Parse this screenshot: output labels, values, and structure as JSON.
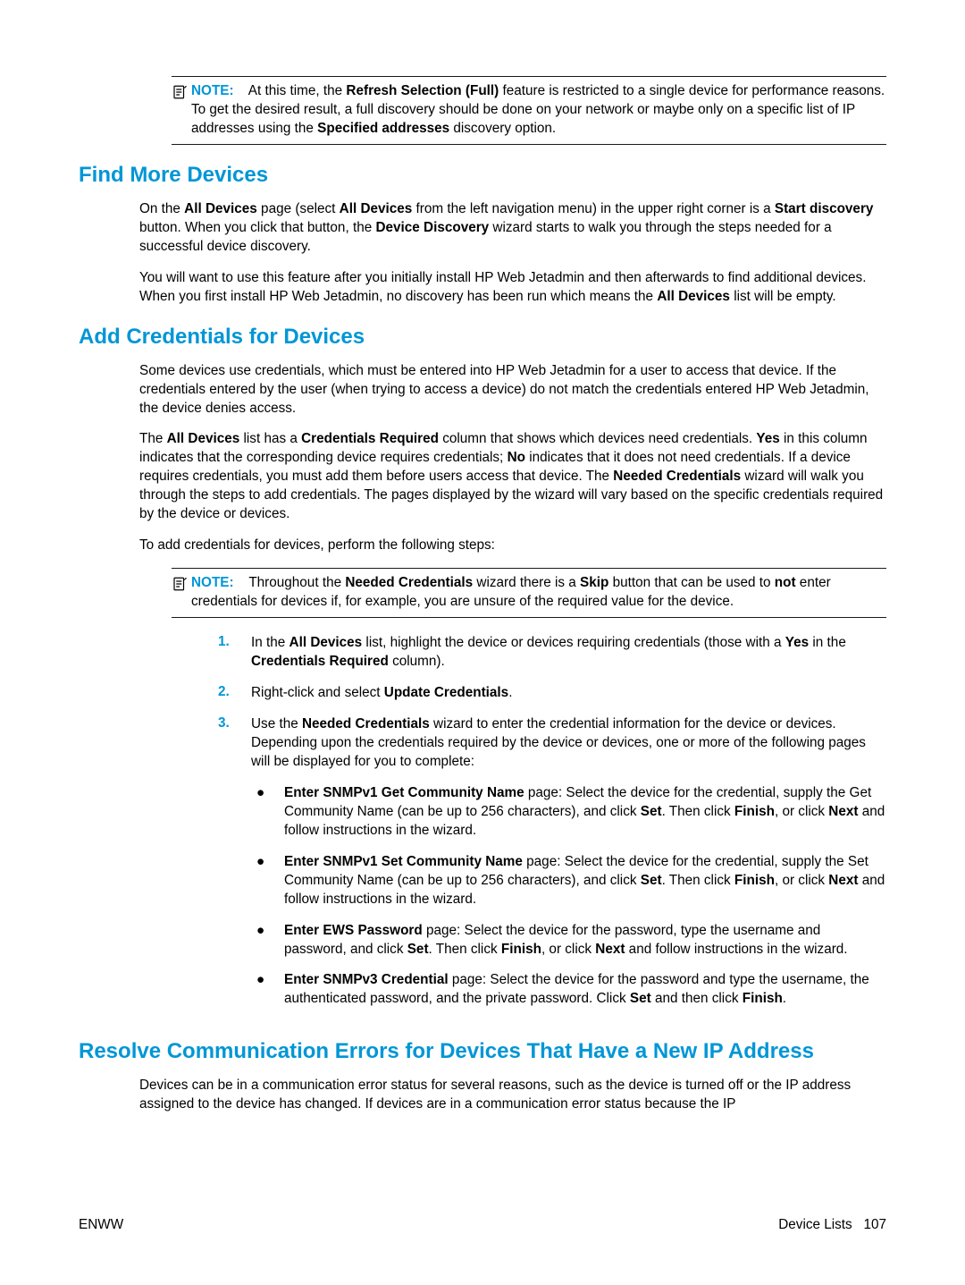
{
  "note_top": {
    "label": "NOTE:",
    "text_before": "At this time, the ",
    "bold1": "Refresh Selection (Full)",
    "text_mid": " feature is restricted to a single device for performance reasons. To get the desired result, a full discovery should be done on your network or maybe only on a specific list of IP addresses using the ",
    "bold2": "Specified addresses",
    "text_after": " discovery option."
  },
  "section1": {
    "title": "Find More Devices",
    "p1_a": "On the ",
    "p1_b": "All Devices",
    "p1_c": " page (select ",
    "p1_d": "All Devices",
    "p1_e": " from the left navigation menu) in the upper right corner is a ",
    "p1_f": "Start discovery",
    "p1_g": " button. When you click that button, the ",
    "p1_h": "Device Discovery",
    "p1_i": " wizard starts to walk you through the steps needed for a successful device discovery.",
    "p2_a": "You will want to use this feature after you initially install HP Web Jetadmin and then afterwards to find additional devices. When you first install HP Web Jetadmin, no discovery has been run which means the ",
    "p2_b": "All Devices",
    "p2_c": " list will be empty."
  },
  "section2": {
    "title": "Add Credentials for Devices",
    "p1": "Some devices use credentials, which must be entered into HP Web Jetadmin for a user to access that device. If the credentials entered by the user (when trying to access a device) do not match the credentials entered HP Web Jetadmin, the device denies access.",
    "p2_a": "The ",
    "p2_b": "All Devices",
    "p2_c": " list has a ",
    "p2_d": "Credentials Required",
    "p2_e": " column that shows which devices need credentials. ",
    "p2_f": "Yes",
    "p2_g": " in this column indicates that the corresponding device requires credentials; ",
    "p2_h": "No",
    "p2_i": " indicates that it does not need credentials. If a device requires credentials, you must add them before users access that device. The ",
    "p2_j": "Needed Credentials",
    "p2_k": " wizard will walk you through the steps to add credentials. The pages displayed by the wizard will vary based on the specific credentials required by the device or devices.",
    "p3": "To add credentials for devices, perform the following steps:",
    "note": {
      "label": "NOTE:",
      "a": "Throughout the ",
      "b": "Needed Credentials",
      "c": " wizard there is a ",
      "d": "Skip",
      "e": " button that can be used to ",
      "f": "not",
      "g": " enter credentials for devices if, for example, you are unsure of the required value for the device."
    },
    "step1": {
      "num": "1.",
      "a": "In the ",
      "b": "All Devices",
      "c": " list, highlight the device or devices requiring credentials (those with a ",
      "d": "Yes",
      "e": " in the ",
      "f": "Credentials Required",
      "g": " column)."
    },
    "step2": {
      "num": "2.",
      "a": "Right-click and select ",
      "b": "Update Credentials",
      "c": "."
    },
    "step3": {
      "num": "3.",
      "a": "Use the ",
      "b": "Needed Credentials",
      "c": " wizard to enter the credential information for the device or devices. Depending upon the credentials required by the device or devices, one or more of the following pages will be displayed for you to complete:"
    },
    "bullet1": {
      "b1": "Enter SNMPv1 Get Community Name",
      "t1": " page: Select the device for the credential, supply the Get Community Name (can be up to 256 characters), and click ",
      "b2": "Set",
      "t2": ". Then click ",
      "b3": "Finish",
      "t3": ", or click ",
      "b4": "Next",
      "t4": " and follow instructions in the wizard."
    },
    "bullet2": {
      "b1": "Enter SNMPv1 Set Community Name",
      "t1": " page: Select the device for the credential, supply the Set Community Name (can be up to 256 characters), and click ",
      "b2": "Set",
      "t2": ". Then click ",
      "b3": "Finish",
      "t3": ", or click ",
      "b4": "Next",
      "t4": " and follow instructions in the wizard."
    },
    "bullet3": {
      "b1": "Enter EWS Password",
      "t1": " page: Select the device for the password, type the username and password, and click ",
      "b2": "Set",
      "t2": ". Then click ",
      "b3": "Finish",
      "t3": ", or click ",
      "b4": "Next",
      "t4": " and follow instructions in the wizard."
    },
    "bullet4": {
      "b1": "Enter SNMPv3 Credential",
      "t1": " page: Select the device for the password and type the username, the authenticated password, and the private password. Click ",
      "b2": "Set",
      "t2": " and then click ",
      "b3": "Finish",
      "t3": "."
    }
  },
  "section3": {
    "title": "Resolve Communication Errors for Devices That Have a New IP Address",
    "p1": "Devices can be in a communication error status for several reasons, such as the device is turned off or the IP address assigned to the device has changed. If devices are in a communication error status because the IP"
  },
  "footer": {
    "left": "ENWW",
    "right_label": "Device Lists",
    "right_page": "107"
  }
}
